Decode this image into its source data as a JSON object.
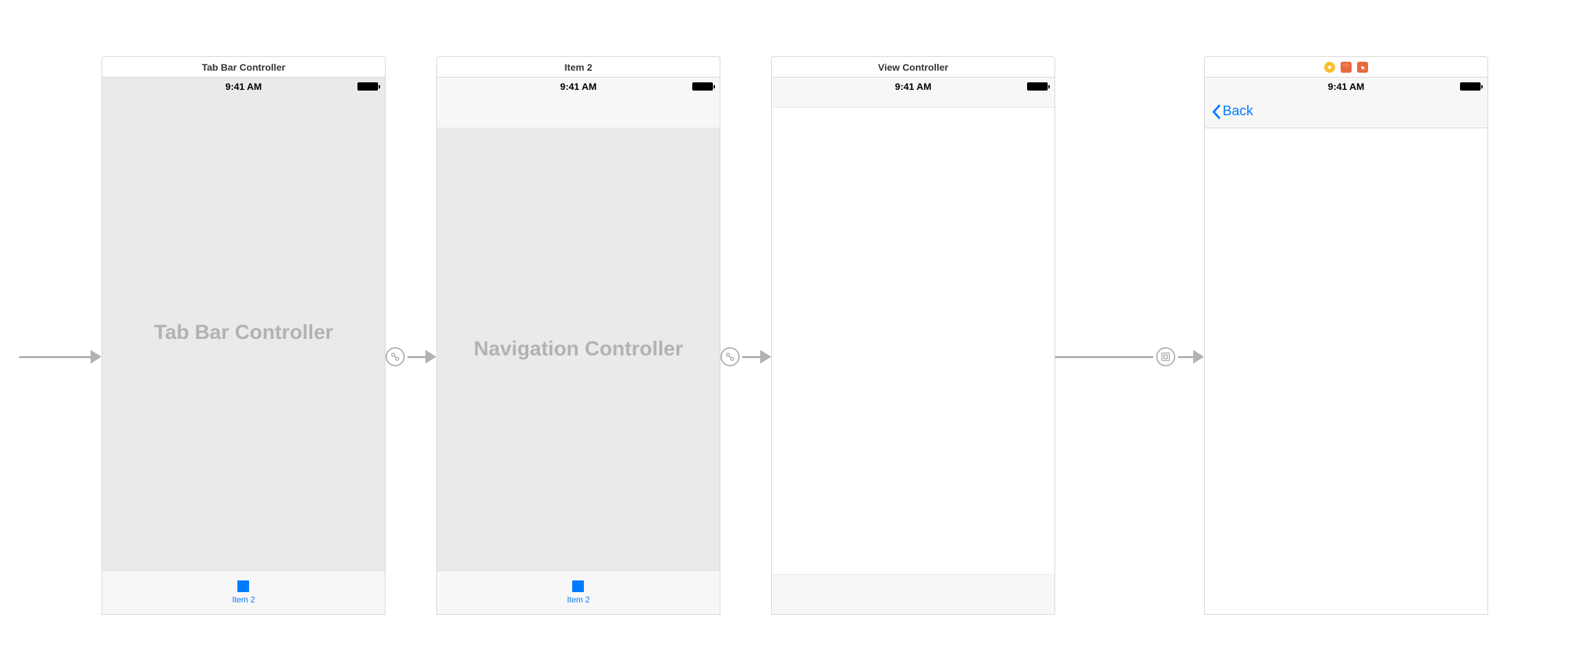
{
  "status_time": "9:41 AM",
  "scenes": {
    "tabbar": {
      "label": "Tab Bar Controller",
      "placeholder": "Tab Bar Controller",
      "tab_item_label": "Item 2"
    },
    "nav": {
      "label": "Item 2",
      "placeholder": "Navigation Controller",
      "tab_item_label": "Item 2"
    },
    "view": {
      "label": "View Controller"
    },
    "detail": {
      "back_label": "Back"
    }
  }
}
